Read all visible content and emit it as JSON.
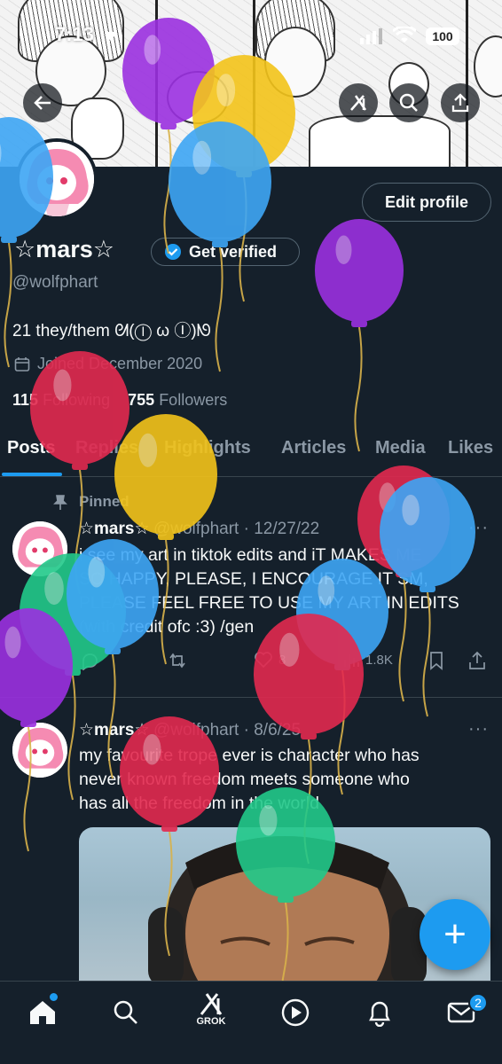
{
  "status_bar": {
    "time": "7:13",
    "battery": "100"
  },
  "banner": {
    "back_icon": "back-arrow-icon",
    "grok_icon": "grok-icon",
    "search_icon": "search-icon",
    "share_icon": "share-icon"
  },
  "profile": {
    "edit_profile_label": "Edit profile",
    "display_name": "☆mars☆",
    "verify_label": "Get verified",
    "handle": "@wolfphart",
    "bio": "21 they/them ᘛ(Ⓘ ω Ⓘ)ᘚ",
    "joined": "Joined December 2020",
    "following_count": "115",
    "following_label": "Following",
    "followers_count": "755",
    "followers_label": "Followers"
  },
  "tabs": [
    "Posts",
    "Replies",
    "Highlights",
    "Articles",
    "Media",
    "Likes"
  ],
  "tweets": [
    {
      "pinned_label": "Pinned",
      "name": "☆mars☆",
      "handle_date": "@wolfphart · 12/27/22",
      "lines": [
        "i see my art in tiktok edits and iT MAKES ME",
        "SO HAPPY, PLEASE, I ENCOURAGE IT SM,",
        "PLEASE FEEL FREE TO USE MY ART IN EDITS",
        "(with credit ofc :3) /gen"
      ],
      "likes": "8",
      "views": "1.8K"
    },
    {
      "name": "☆mars☆",
      "handle_date": "@wolfphart · 8/6/25",
      "lines": [
        "my favourite trope ever is character who has",
        "never known freedom meets someone who",
        "has all the freedom in the world"
      ]
    }
  ],
  "fab_label": "+",
  "nav": {
    "grok_label": "GROK",
    "messages_badge": "2"
  },
  "colors": {
    "background": "#15202b",
    "accent": "#1d9bf0",
    "muted": "#8b98a5",
    "balloon_purple": "#9b30e0",
    "balloon_yellow": "#f3c41a",
    "balloon_blue": "#3ea6f5",
    "balloon_red": "#e2294f",
    "balloon_green": "#22c98a"
  }
}
